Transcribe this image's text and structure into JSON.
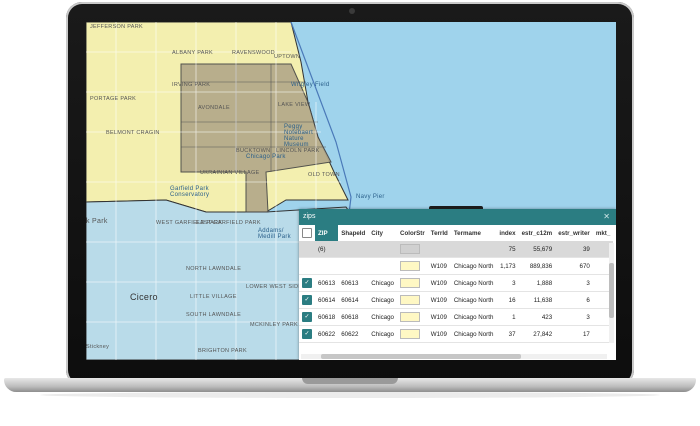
{
  "map": {
    "labels": {
      "jefferson_park": "JEFFERSON PARK",
      "albany_park": "ALBANY PARK",
      "ravenswood": "RAVENSWOOD",
      "uptown": "UPTOWN",
      "portage_park": "PORTAGE PARK",
      "irving_park": "IRVING PARK",
      "avondale": "AVONDALE",
      "lake_view": "LAKE VIEW",
      "wrigley_field": "Wrigley Field",
      "belmont_cragin": "BELMONT CRAGIN",
      "bucktown": "BUCKTOWN",
      "peggy_nature_museum": "Peggy Notebaert Nature Museum",
      "chicago_park": "Chicago Park",
      "lincoln_park": "LINCOLN PARK",
      "ukrainian_village": "UKRAINIAN VILLAGE",
      "old_town": "OLD TOWN",
      "garfield_park": "Garfield Park Conservatory",
      "west_garfield_park": "WEST GARFIELD PARK",
      "east_garfield_park": "EAST GARFIELD PARK",
      "oak_park": "k Park",
      "navy_pier": "Navy Pier",
      "addams_medill": "Addams/ Medill Park",
      "north_lawndale": "NORTH LAWNDALE",
      "cicero": "Cicero",
      "little_village": "LITTLE VILLAGE",
      "lower_west_side": "LOWER WEST SIDE",
      "south_lawndale": "SOUTH LAWNDALE",
      "mckinley_park": "MCKINLEY PARK",
      "brighton_park": "BRIGHTON PARK",
      "stickney": "Stickney"
    }
  },
  "panel": {
    "title": "zips",
    "close_icon": "close-icon",
    "columns": [
      "ZIP",
      "ShapeId",
      "City",
      "ColorStr",
      "TerrId",
      "Termame",
      "index",
      "estr_c12m",
      "estr_writer",
      "mkt_"
    ],
    "aggregate_row": {
      "count": "(6)",
      "index": "75",
      "estr_c12m": "55,679",
      "estr_writer": "39"
    },
    "rows": [
      {
        "checked": false,
        "zip": "",
        "shape": "",
        "city": "",
        "color": "#fff8c4",
        "terr": "W109",
        "termame": "Chicago North",
        "index": "1,173",
        "estr_c12m": "889,836",
        "estr_writer": "670"
      },
      {
        "checked": true,
        "zip": "60613",
        "shape": "60613",
        "city": "Chicago",
        "color": "#fff8c4",
        "terr": "W109",
        "termame": "Chicago North",
        "index": "3",
        "estr_c12m": "1,888",
        "estr_writer": "3"
      },
      {
        "checked": true,
        "zip": "60614",
        "shape": "60614",
        "city": "Chicago",
        "color": "#fff8c4",
        "terr": "W109",
        "termame": "Chicago North",
        "index": "16",
        "estr_c12m": "11,638",
        "estr_writer": "6"
      },
      {
        "checked": true,
        "zip": "60618",
        "shape": "60618",
        "city": "Chicago",
        "color": "#fff8c4",
        "terr": "W109",
        "termame": "Chicago North",
        "index": "1",
        "estr_c12m": "423",
        "estr_writer": "3"
      },
      {
        "checked": true,
        "zip": "60622",
        "shape": "60622",
        "city": "Chicago",
        "color": "#fff8c4",
        "terr": "W109",
        "termame": "Chicago North",
        "index": "37",
        "estr_c12m": "27,842",
        "estr_writer": "17"
      }
    ]
  },
  "colors": {
    "header": "#2b7d82",
    "territory_north": "#f3efaf",
    "territory_south": "#b9dbe9",
    "selected_zip": "#b3a98a",
    "water": "#9fd3ec"
  }
}
